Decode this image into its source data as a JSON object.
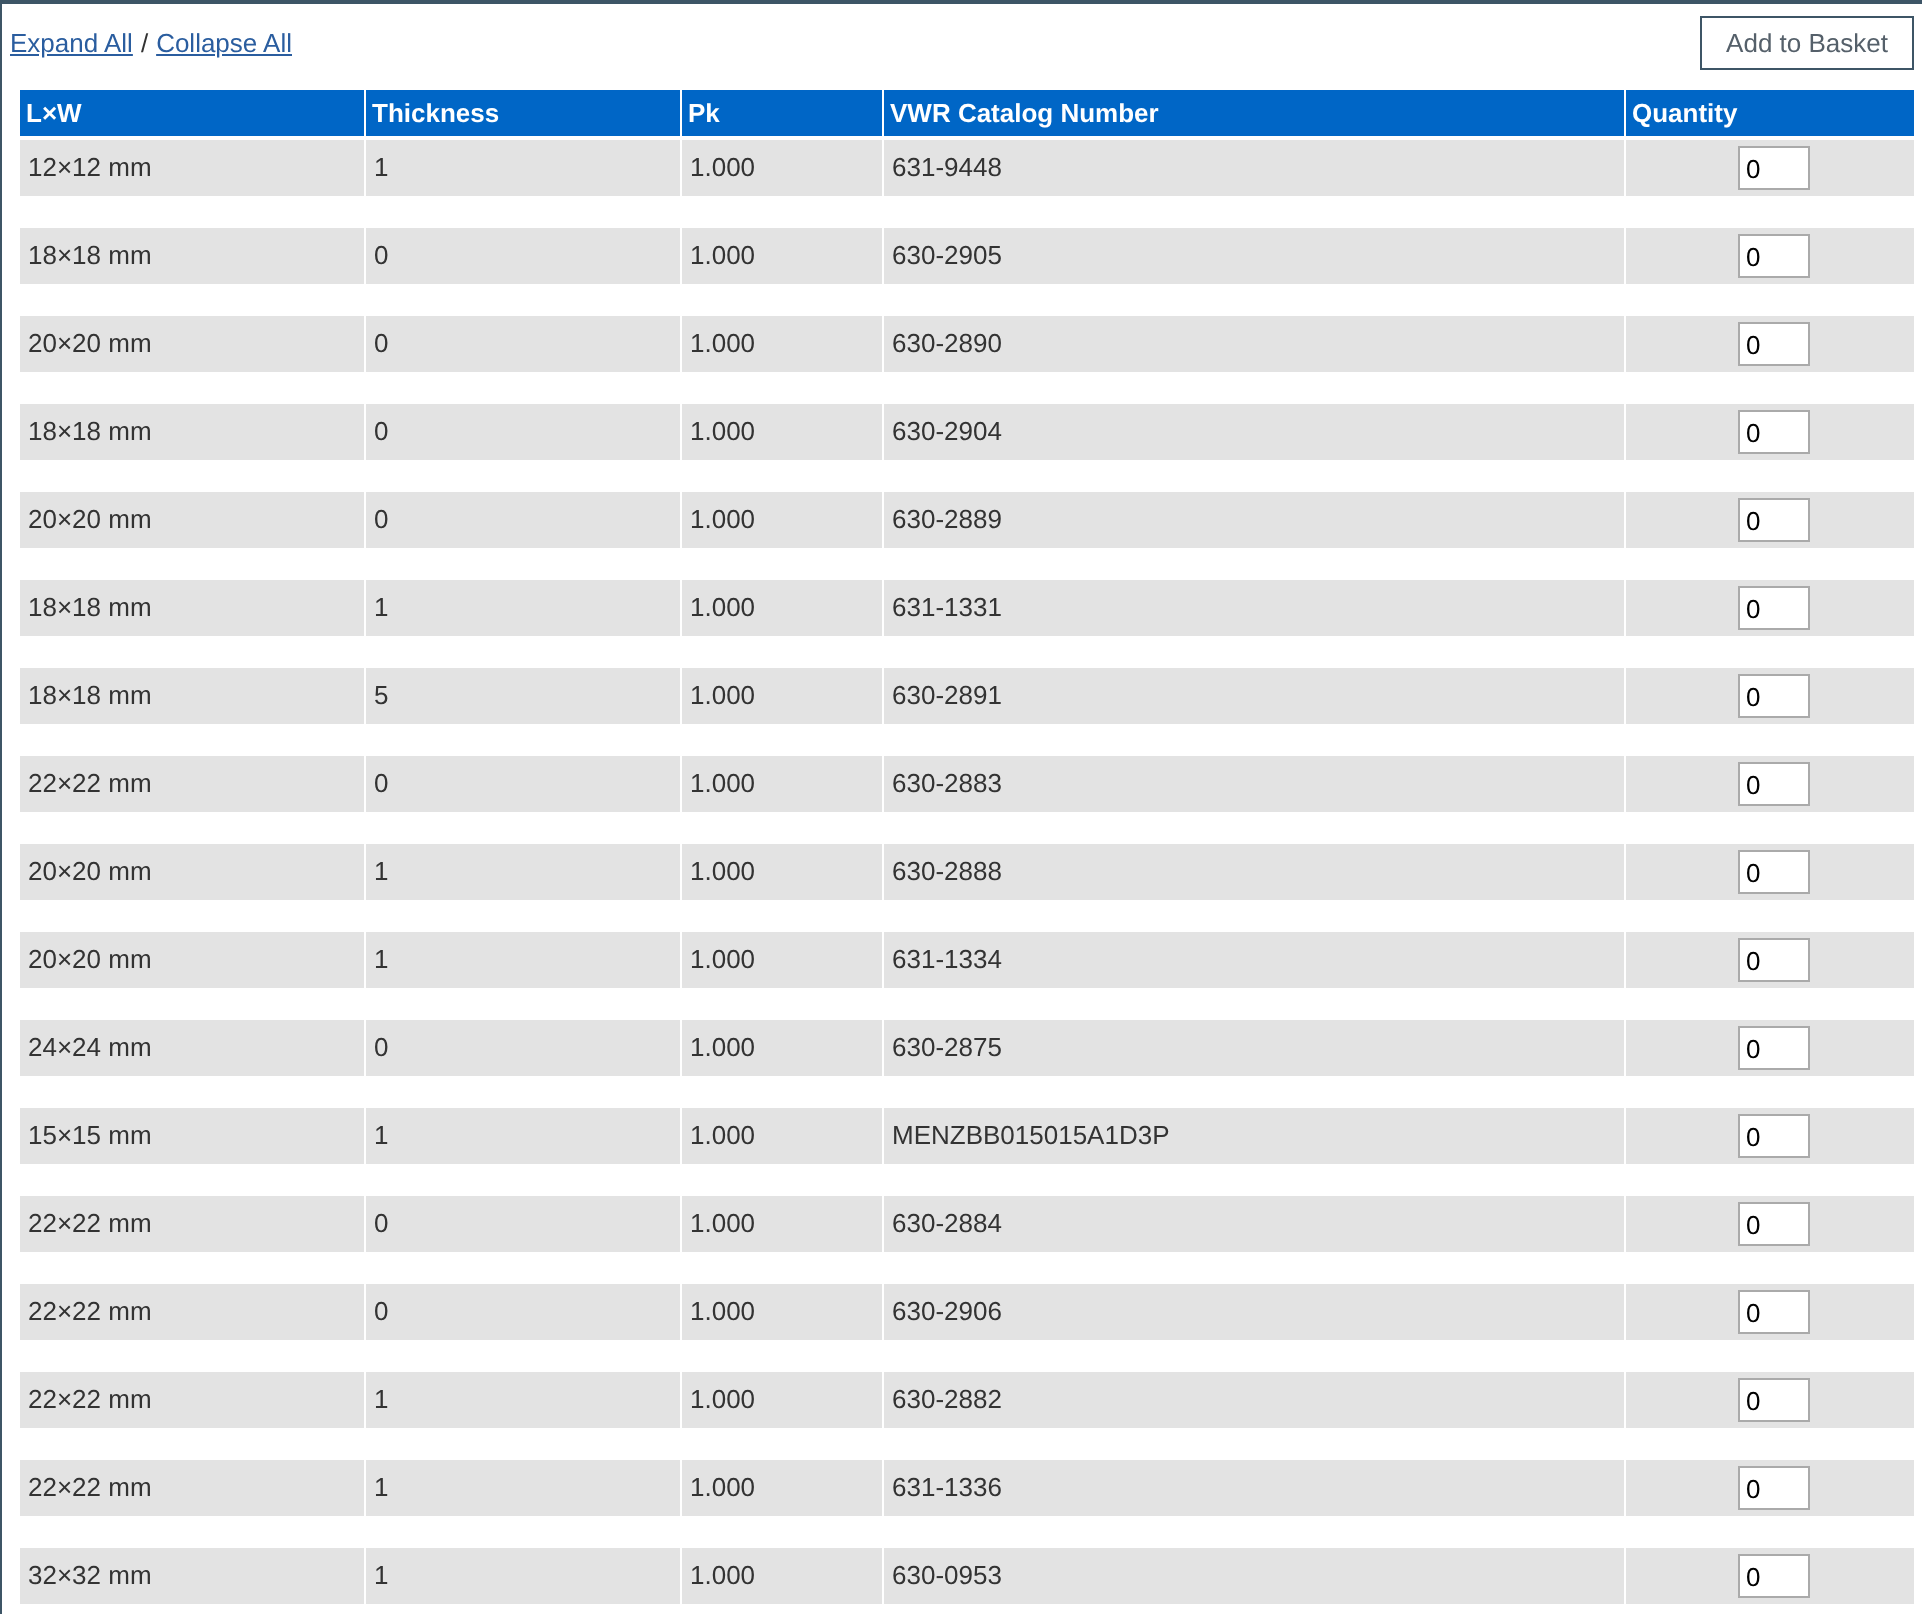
{
  "links": [
    "Expand All",
    "Collapse All"
  ],
  "separator": "/",
  "add_button": "Add to Basket",
  "table": {
    "columns": [
      "L×W",
      "Thickness",
      "Pk",
      "VWR Catalog Number",
      "Quantity"
    ],
    "rows": [
      {
        "size": "12×12 mm",
        "thickness": "1",
        "pk": "1.000",
        "catalog": "631-9448",
        "quantity": "0"
      },
      {
        "size": "18×18 mm",
        "thickness": "0",
        "pk": "1.000",
        "catalog": "630-2905",
        "quantity": "0"
      },
      {
        "size": "20×20 mm",
        "thickness": "0",
        "pk": "1.000",
        "catalog": "630-2890",
        "quantity": "0"
      },
      {
        "size": "18×18 mm",
        "thickness": "0",
        "pk": "1.000",
        "catalog": "630-2904",
        "quantity": "0"
      },
      {
        "size": "20×20 mm",
        "thickness": "0",
        "pk": "1.000",
        "catalog": "630-2889",
        "quantity": "0"
      },
      {
        "size": "18×18 mm",
        "thickness": "1",
        "pk": "1.000",
        "catalog": "631-1331",
        "quantity": "0"
      },
      {
        "size": "18×18 mm",
        "thickness": "5",
        "pk": "1.000",
        "catalog": "630-2891",
        "quantity": "0"
      },
      {
        "size": "22×22 mm",
        "thickness": "0",
        "pk": "1.000",
        "catalog": "630-2883",
        "quantity": "0"
      },
      {
        "size": "20×20 mm",
        "thickness": "1",
        "pk": "1.000",
        "catalog": "630-2888",
        "quantity": "0"
      },
      {
        "size": "20×20 mm",
        "thickness": "1",
        "pk": "1.000",
        "catalog": "631-1334",
        "quantity": "0"
      },
      {
        "size": "24×24 mm",
        "thickness": "0",
        "pk": "1.000",
        "catalog": "630-2875",
        "quantity": "0"
      },
      {
        "size": "15×15 mm",
        "thickness": "1",
        "pk": "1.000",
        "catalog": "MENZBB015015A1D3P",
        "quantity": "0"
      },
      {
        "size": "22×22 mm",
        "thickness": "0",
        "pk": "1.000",
        "catalog": "630-2884",
        "quantity": "0"
      },
      {
        "size": "22×22 mm",
        "thickness": "0",
        "pk": "1.000",
        "catalog": "630-2906",
        "quantity": "0"
      },
      {
        "size": "22×22 mm",
        "thickness": "1",
        "pk": "1.000",
        "catalog": "630-2882",
        "quantity": "0"
      },
      {
        "size": "22×22 mm",
        "thickness": "1",
        "pk": "1.000",
        "catalog": "631-1336",
        "quantity": "0"
      },
      {
        "size": "32×32 mm",
        "thickness": "1",
        "pk": "1.000",
        "catalog": "630-0953",
        "quantity": "0"
      }
    ]
  }
}
